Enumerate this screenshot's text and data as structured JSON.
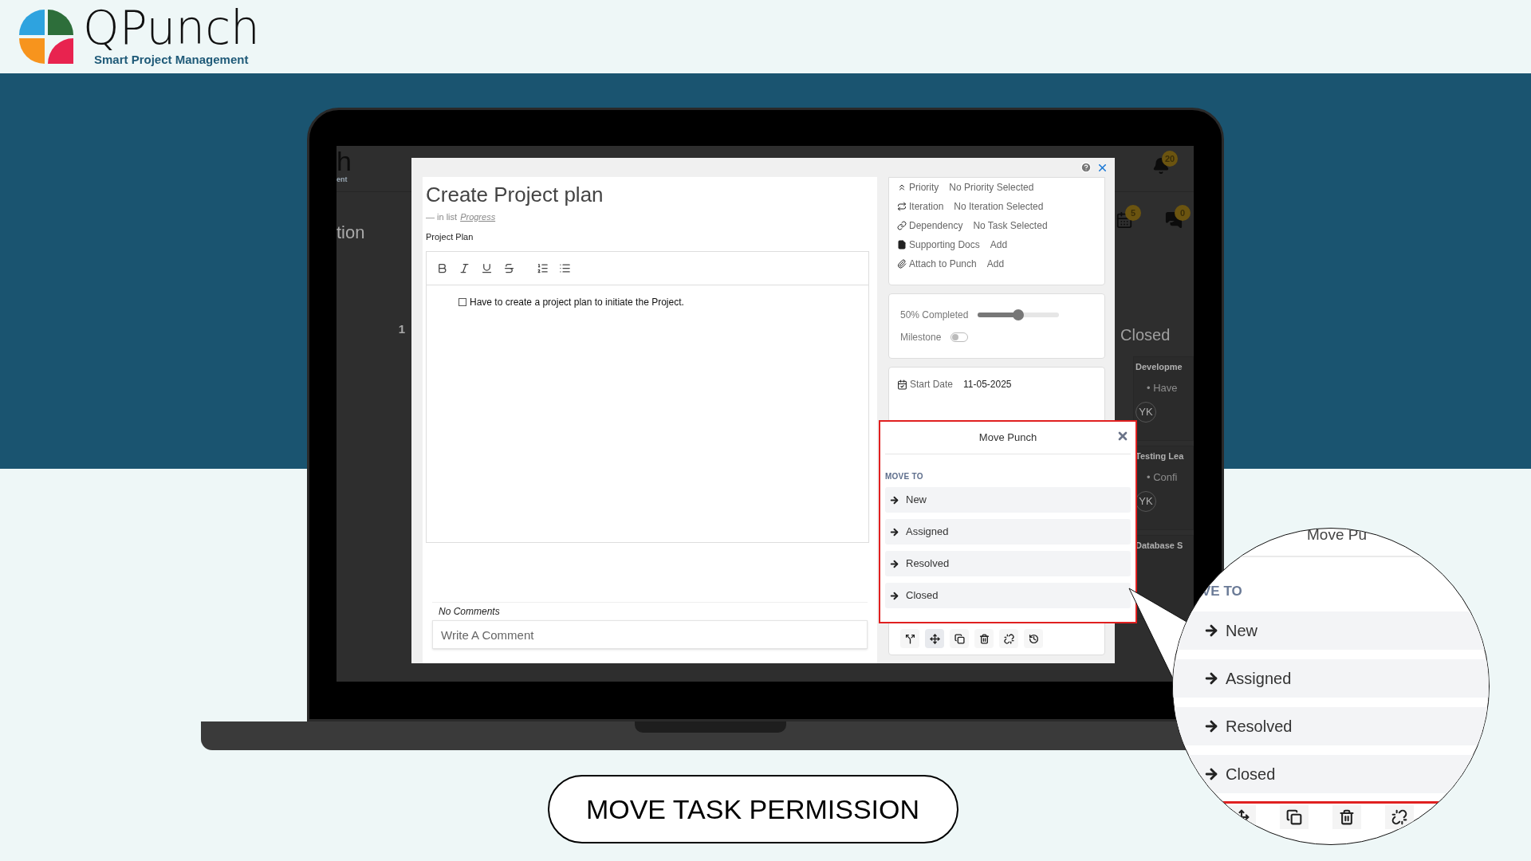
{
  "brand": {
    "name": "QPunch",
    "tagline": "Smart Project Management"
  },
  "background_app": {
    "logo_fragment": "h",
    "tagline_fragment": "ent",
    "heading_fragment": "tion",
    "column_count": "1",
    "notification_count": "20",
    "calendar_count": "5",
    "chat_count": "0",
    "column_title": "Closed",
    "cards": [
      {
        "title": "Developme",
        "bullet": "• Have",
        "avatar": "YK"
      },
      {
        "title": "Testing Lea",
        "bullet": "• Confi",
        "avatar": "YK"
      },
      {
        "title": "Database S"
      }
    ]
  },
  "task": {
    "title": "Create Project plan",
    "list_prefix": "— in list",
    "list": "Progress",
    "description_label": "Project Plan",
    "checklist": [
      {
        "text": "Have to create a project plan to initiate the Project.",
        "checked": false
      }
    ],
    "comments_status": "No Comments",
    "comment_placeholder": "Write A Comment"
  },
  "details": [
    {
      "label": "Priority",
      "value": "No Priority Selected"
    },
    {
      "label": "Iteration",
      "value": "No Iteration Selected"
    },
    {
      "label": "Dependency",
      "value": "No Task Selected"
    },
    {
      "label": "Supporting Docs",
      "value": "Add"
    },
    {
      "label": "Attach to Punch",
      "value": "Add"
    }
  ],
  "progress": {
    "label": "50% Completed",
    "level": 0.5
  },
  "milestone": {
    "label": "Milestone",
    "on": false
  },
  "dates": [
    {
      "label": "Start Date",
      "value": "11-05-2025"
    }
  ],
  "move_punch": {
    "title": "Move Punch",
    "section": "MOVE TO",
    "targets": [
      "New",
      "Assigned",
      "Resolved",
      "Closed"
    ]
  },
  "magnifier": {
    "title": "Move Pu",
    "section": "VE TO",
    "targets": [
      "New",
      "Assigned",
      "Resolved",
      "Closed"
    ]
  },
  "caption": "MOVE TASK PERMISSION"
}
